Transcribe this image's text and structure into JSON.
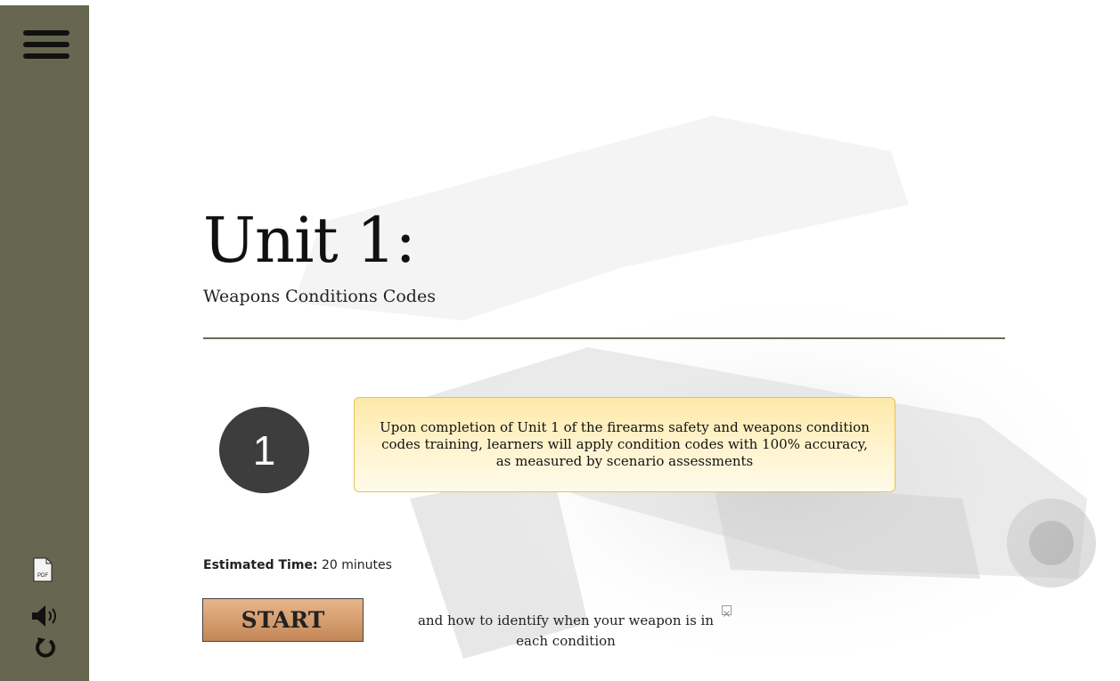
{
  "sidebar": {
    "menu_icon": "hamburger-menu-icon",
    "pdf_label": "PDF",
    "pdf_icon": "pdf-document-icon",
    "audio_icon": "speaker-volume-icon",
    "restart_icon": "restart-icon"
  },
  "unit": {
    "title": "Unit 1:",
    "subtitle": "Weapons Conditions Codes"
  },
  "objective": {
    "number": "1",
    "text": "Upon completion of Unit 1 of the firearms safety and weapons condition codes training, learners will apply condition codes with 100% accuracy, as measured by scenario assessments"
  },
  "estimated_time": {
    "label": "Estimated Time:",
    "value": "20 minutes"
  },
  "start_button": "START",
  "caption": {
    "text": "and how to identify when your weapon is in each condition",
    "close_icon": "close-icon"
  },
  "colors": {
    "sidebar": "#676751",
    "divider": "#6b6b55",
    "objective_circle": "#3d3d3d",
    "objective_box": "#fde9a8",
    "start_button": "#d49d6e"
  }
}
